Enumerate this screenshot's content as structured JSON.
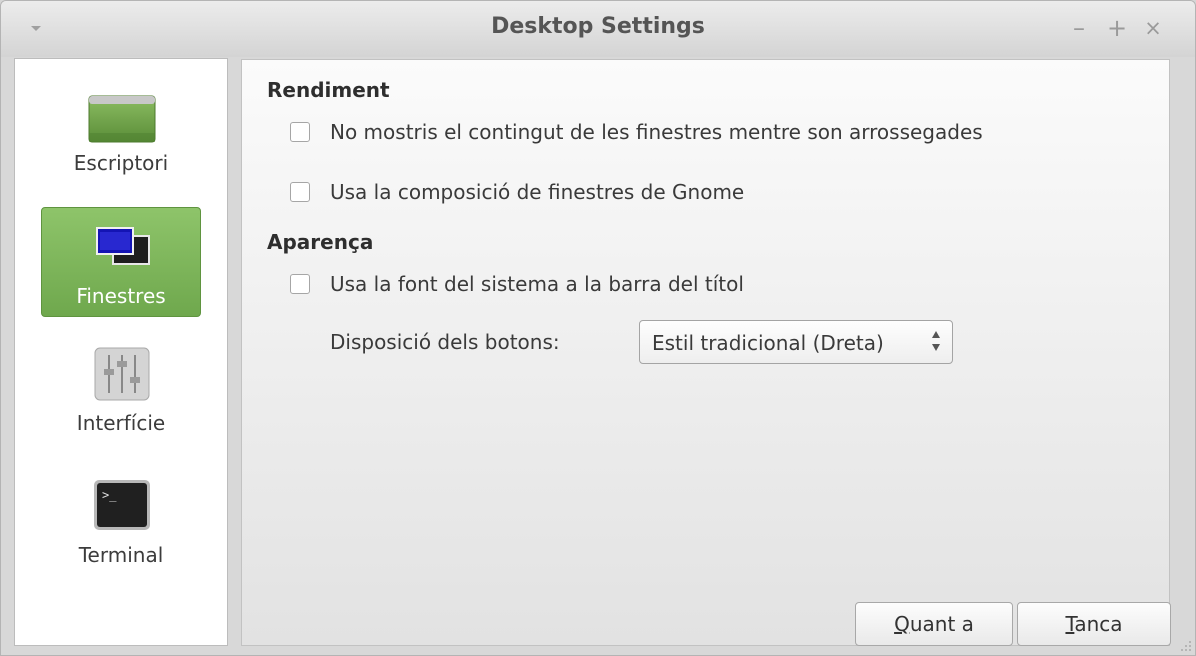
{
  "window": {
    "title": "Desktop Settings"
  },
  "titlebar_controls": {
    "minimize": "–",
    "maximize": "+",
    "close": "×"
  },
  "sidebar": {
    "items": [
      {
        "label": "Escriptori",
        "icon": "desktop-icon",
        "selected": false
      },
      {
        "label": "Finestres",
        "icon": "windows-icon",
        "selected": true
      },
      {
        "label": "Interfície",
        "icon": "sliders-icon",
        "selected": false
      },
      {
        "label": "Terminal",
        "icon": "terminal-icon",
        "selected": false
      }
    ]
  },
  "performance": {
    "title": "Rendiment",
    "no_drag_contents": {
      "label": "No mostris el contingut de les finestres mentre son arrossegades",
      "checked": false
    },
    "gnome_compositing": {
      "label": "Usa la composició de finestres de Gnome",
      "checked": false
    }
  },
  "appearance": {
    "title": "Aparença",
    "system_font": {
      "label": "Usa la font del sistema a la barra del títol",
      "checked": false
    },
    "button_layout": {
      "label": "Disposició dels botons:",
      "value": "Estil tradicional (Dreta)"
    }
  },
  "buttons": {
    "about": {
      "mnemonic": "Q",
      "rest": "uant a"
    },
    "close": {
      "mnemonic": "T",
      "rest": "anca"
    }
  }
}
